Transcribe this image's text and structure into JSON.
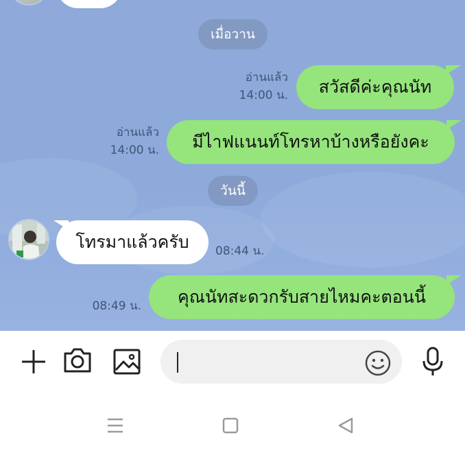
{
  "dates": {
    "yesterday": "เมื่อวาน",
    "today": "วันนี้"
  },
  "messages": [
    {
      "direction": "out",
      "text": "สวัสดีค่ะคุณนัท",
      "read": "อ่านแล้ว",
      "time": "14:00 น."
    },
    {
      "direction": "out",
      "text": "มีไาฟแนนท์โทรหาบ้างหรือยังคะ",
      "read": "อ่านแล้ว",
      "time": "14:00 น."
    },
    {
      "direction": "in",
      "text": "โทรมาแล้วครับ",
      "time": "08:44 น."
    },
    {
      "direction": "out",
      "text": "คุณนัทสะดวกรับสายไหมคะตอนนี้",
      "time": "08:49 น."
    }
  ],
  "composer": {
    "placeholder": ""
  },
  "icons": {
    "add": "plus-icon",
    "camera": "camera-icon",
    "gallery": "image-icon",
    "emoji": "emoji-icon",
    "voice": "microphone-icon",
    "nav_menu": "menu-icon",
    "nav_home": "home-icon",
    "nav_back": "back-icon"
  },
  "colors": {
    "chat_background": "#8eaadb",
    "outgoing_bubble": "#95e47c",
    "incoming_bubble": "#ffffff",
    "date_pill": "#7b8fb4"
  }
}
